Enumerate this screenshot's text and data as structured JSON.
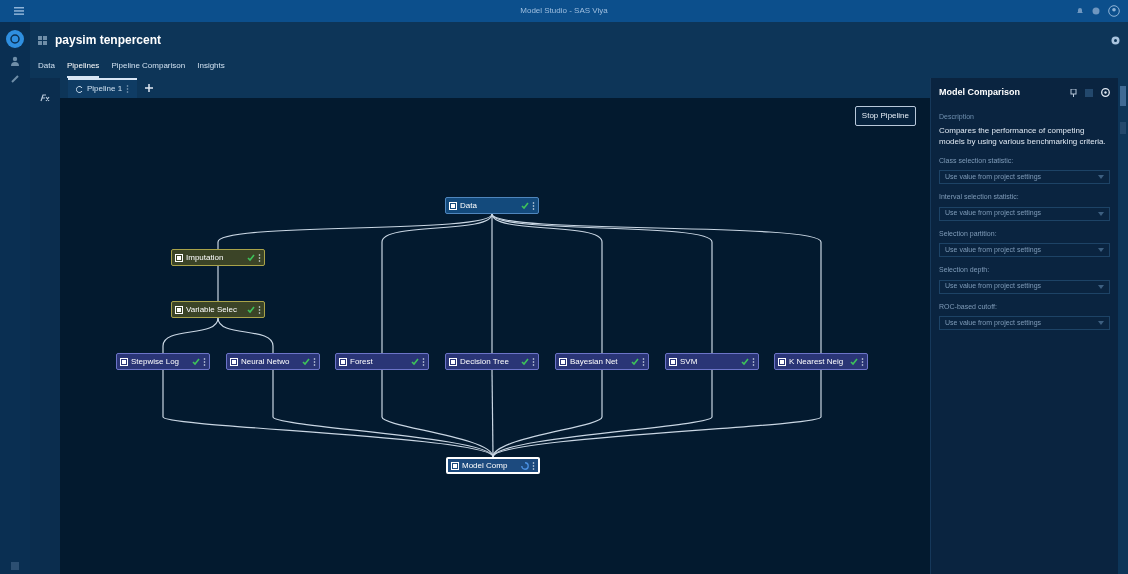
{
  "title_bar": {
    "title": "Model Studio - SAS Viya"
  },
  "project": {
    "name": "paysim tenpercent"
  },
  "tabs": [
    {
      "label": "Data",
      "selected": false
    },
    {
      "label": "Pipelines",
      "selected": true
    },
    {
      "label": "Pipeline Comparison",
      "selected": false
    },
    {
      "label": "Insights",
      "selected": false
    }
  ],
  "pipeline_tabs": [
    {
      "label": "Pipeline 1",
      "selected": true
    }
  ],
  "canvas": {
    "run_button": "Stop Pipeline",
    "nodes": [
      {
        "label": "Data",
        "kind": "data",
        "completed": true,
        "selected": false
      },
      {
        "label": "Imputation",
        "kind": "preprocess",
        "completed": true,
        "selected": false
      },
      {
        "label": "Variable Selec",
        "kind": "preprocess",
        "completed": true,
        "selected": false
      },
      {
        "label": "Stepwise Log",
        "kind": "model",
        "completed": true,
        "selected": false
      },
      {
        "label": "Neural Netwo",
        "kind": "model",
        "completed": true,
        "selected": false
      },
      {
        "label": "Forest",
        "kind": "model",
        "completed": true,
        "selected": false
      },
      {
        "label": "Decision Tree",
        "kind": "model",
        "completed": true,
        "selected": false
      },
      {
        "label": "Bayesian Net",
        "kind": "model",
        "completed": true,
        "selected": false
      },
      {
        "label": "SVM",
        "kind": "model",
        "completed": true,
        "selected": false
      },
      {
        "label": "K Nearest Neig",
        "kind": "model",
        "completed": true,
        "selected": false
      },
      {
        "label": "Model Comp",
        "kind": "compare",
        "completed": false,
        "selected": true
      }
    ]
  },
  "properties": {
    "title": "Model Comparison",
    "section": "Description",
    "description": "Compares the performance of competing models by using various benchmarking criteria.",
    "fields": [
      {
        "label": "Class selection statistic:",
        "value": "Use value from project settings"
      },
      {
        "label": "Interval selection statistic:",
        "value": "Use value from project settings"
      },
      {
        "label": "Selection partition:",
        "value": "Use value from project settings"
      },
      {
        "label": "Selection depth:",
        "value": "Use value from project settings"
      },
      {
        "label": "ROC-based cutoff:",
        "value": "Use value from project settings"
      }
    ]
  }
}
